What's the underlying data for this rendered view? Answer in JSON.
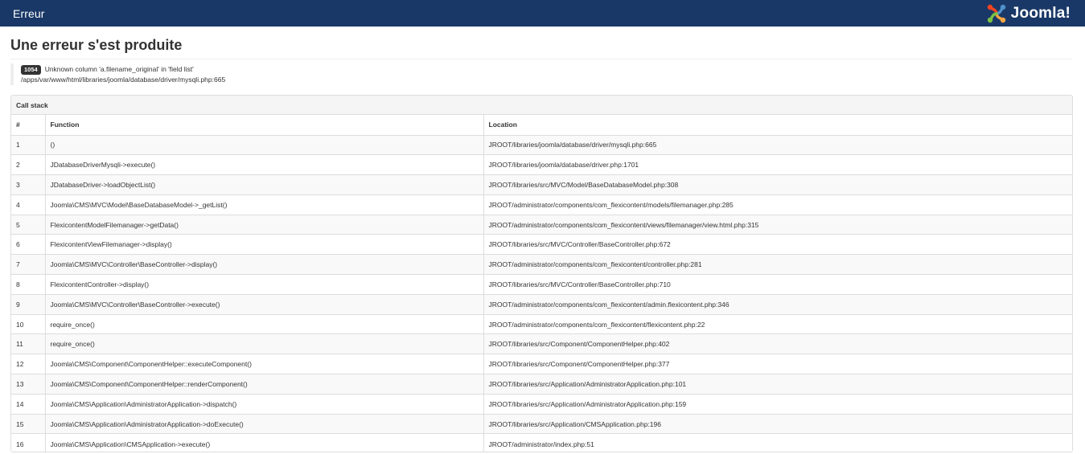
{
  "header": {
    "title": "Erreur",
    "brand": "Joomla!"
  },
  "page": {
    "heading": "Une erreur s'est produite"
  },
  "error": {
    "code": "1054",
    "message": "Unknown column 'a.filename_original' in 'field list'",
    "file": "/apps/var/www/html/libraries/joomla/database/driver/mysqli.php:665"
  },
  "callstack": {
    "title": "Call stack",
    "columns": [
      "#",
      "Function",
      "Location"
    ],
    "rows": [
      [
        "1",
        "()",
        "JROOT/libraries/joomla/database/driver/mysqli.php:665"
      ],
      [
        "2",
        "JDatabaseDriverMysqli->execute()",
        "JROOT/libraries/joomla/database/driver.php:1701"
      ],
      [
        "3",
        "JDatabaseDriver->loadObjectList()",
        "JROOT/libraries/src/MVC/Model/BaseDatabaseModel.php:308"
      ],
      [
        "4",
        "Joomla\\CMS\\MVC\\Model\\BaseDatabaseModel->_getList()",
        "JROOT/administrator/components/com_flexicontent/models/filemanager.php:285"
      ],
      [
        "5",
        "FlexicontentModelFilemanager->getData()",
        "JROOT/administrator/components/com_flexicontent/views/filemanager/view.html.php:315"
      ],
      [
        "6",
        "FlexicontentViewFilemanager->display()",
        "JROOT/libraries/src/MVC/Controller/BaseController.php:672"
      ],
      [
        "7",
        "Joomla\\CMS\\MVC\\Controller\\BaseController->display()",
        "JROOT/administrator/components/com_flexicontent/controller.php:281"
      ],
      [
        "8",
        "FlexicontentController->display()",
        "JROOT/libraries/src/MVC/Controller/BaseController.php:710"
      ],
      [
        "9",
        "Joomla\\CMS\\MVC\\Controller\\BaseController->execute()",
        "JROOT/administrator/components/com_flexicontent/admin.flexicontent.php:346"
      ],
      [
        "10",
        "require_once()",
        "JROOT/administrator/components/com_flexicontent/flexicontent.php:22"
      ],
      [
        "11",
        "require_once()",
        "JROOT/libraries/src/Component/ComponentHelper.php:402"
      ],
      [
        "12",
        "Joomla\\CMS\\Component\\ComponentHelper::executeComponent()",
        "JROOT/libraries/src/Component/ComponentHelper.php:377"
      ],
      [
        "13",
        "Joomla\\CMS\\Component\\ComponentHelper::renderComponent()",
        "JROOT/libraries/src/Application/AdministratorApplication.php:101"
      ],
      [
        "14",
        "Joomla\\CMS\\Application\\AdministratorApplication->dispatch()",
        "JROOT/libraries/src/Application/AdministratorApplication.php:159"
      ],
      [
        "15",
        "Joomla\\CMS\\Application\\AdministratorApplication->doExecute()",
        "JROOT/libraries/src/Application/CMSApplication.php:196"
      ],
      [
        "16",
        "Joomla\\CMS\\Application\\CMSApplication->execute()",
        "JROOT/administrator/index.php:51"
      ]
    ]
  },
  "colors": {
    "header_bg": "#1a3867",
    "logo_red": "#f44321",
    "logo_orange": "#f9a541",
    "logo_green": "#7ac143",
    "logo_blue": "#5091cd"
  }
}
